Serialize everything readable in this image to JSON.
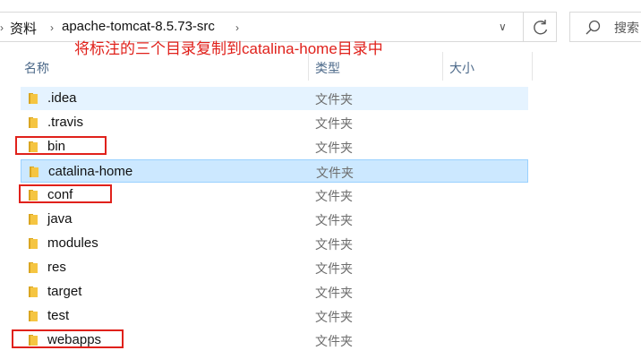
{
  "address_bar": {
    "crumbs": [
      "资料",
      "apache-tomcat-8.5.73-src"
    ]
  },
  "search": {
    "placeholder": "搜索"
  },
  "annotation": {
    "text": "将标注的三个目录复制到catalina-home目录中"
  },
  "columns": {
    "name": "名称",
    "type": "类型",
    "size": "大小"
  },
  "files": [
    {
      "name": ".idea",
      "type": "文件夹",
      "state": "hover"
    },
    {
      "name": ".travis",
      "type": "文件夹",
      "state": ""
    },
    {
      "name": "bin",
      "type": "文件夹",
      "state": "",
      "highlighted": true
    },
    {
      "name": "catalina-home",
      "type": "文件夹",
      "state": "selected"
    },
    {
      "name": "conf",
      "type": "文件夹",
      "state": "",
      "highlighted": true
    },
    {
      "name": "java",
      "type": "文件夹",
      "state": ""
    },
    {
      "name": "modules",
      "type": "文件夹",
      "state": ""
    },
    {
      "name": "res",
      "type": "文件夹",
      "state": ""
    },
    {
      "name": "target",
      "type": "文件夹",
      "state": ""
    },
    {
      "name": "test",
      "type": "文件夹",
      "state": ""
    },
    {
      "name": "webapps",
      "type": "文件夹",
      "state": "",
      "highlighted": true
    }
  ],
  "colors": {
    "annotation": "#e0211b",
    "folder": "#f5c542",
    "selected_bg": "#cce8ff",
    "hover_bg": "#e5f3ff"
  },
  "icons": [
    "chevron-right-icon",
    "chevron-down-icon",
    "refresh-icon",
    "search-icon",
    "folder-icon"
  ]
}
